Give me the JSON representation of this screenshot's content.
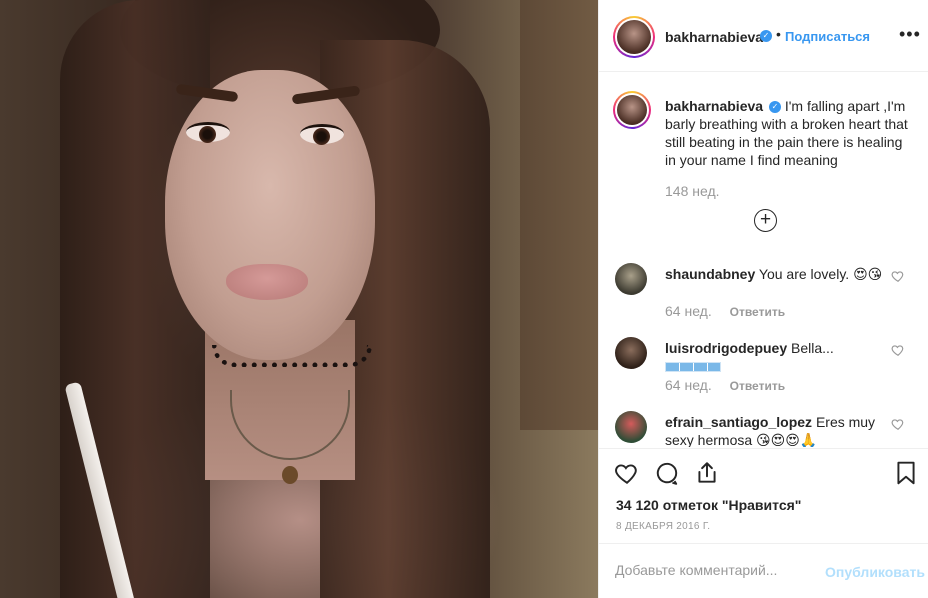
{
  "post": {
    "author": "bakharnabieva",
    "follow_label": "Подписаться",
    "dot": "•",
    "more": "•••"
  },
  "caption": {
    "username": "bakharnabieva",
    "text": "I'm falling apart ,I'm barly breathing with a broken heart that still beating in the pain there is healing in your name I find meaning",
    "time": "148 нед.",
    "plus": "+"
  },
  "comments": [
    {
      "username": "shaundabney",
      "text": "You are lovely. 😍😘",
      "time": "64 нед.",
      "reply": "Ответить"
    },
    {
      "username": "luisrodrigodepuey",
      "text": "Bella...",
      "time": "64 нед.",
      "reply": "Ответить"
    },
    {
      "username": "efrain_santiago_lopez",
      "text": "Eres muy sexy hermosa 😘😍😍🙏",
      "time": "",
      "reply": ""
    }
  ],
  "actions": {
    "likes": "34 120 отметок \"Нравится\"",
    "date": "8 декабря 2016 г."
  },
  "add_comment": {
    "placeholder": "Добавьте комментарий...",
    "publish": "Опубликовать"
  },
  "colors": {
    "link_blue": "#3897f0",
    "publish_disabled": "#b2dffc",
    "muted": "#999999"
  },
  "icons": [
    "verified-badge-icon",
    "more-options-icon",
    "add-icon",
    "heart-icon",
    "comment-icon",
    "share-icon",
    "bookmark-icon"
  ]
}
